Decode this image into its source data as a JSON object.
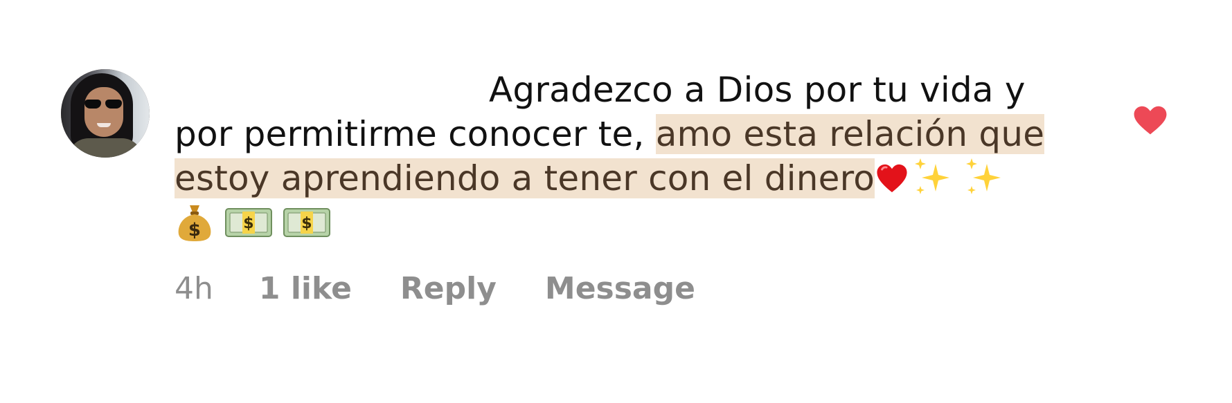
{
  "comment": {
    "avatar_alt": "profile photo",
    "line1": "Agradezco a Dios por tu vida y",
    "line2_plain": "por permitirme conocer te, ",
    "line2_highlight": "amo esta relación que",
    "line3_highlight": "estoy aprendiendo a tener con el dinero",
    "emoji_tail": [
      "red-heart",
      "sparkles",
      "sparkles"
    ],
    "emoji_row": [
      "money-bag",
      "dollar-banknote",
      "dollar-banknote"
    ]
  },
  "footer": {
    "time": "4h",
    "likes": "1 like",
    "reply": "Reply",
    "message": "Message"
  },
  "colors": {
    "highlight_bg": "#f2e2cf",
    "highlight_text": "#4a3727",
    "meta_text": "#8e8e8e",
    "like_heart": "#ed4956"
  }
}
